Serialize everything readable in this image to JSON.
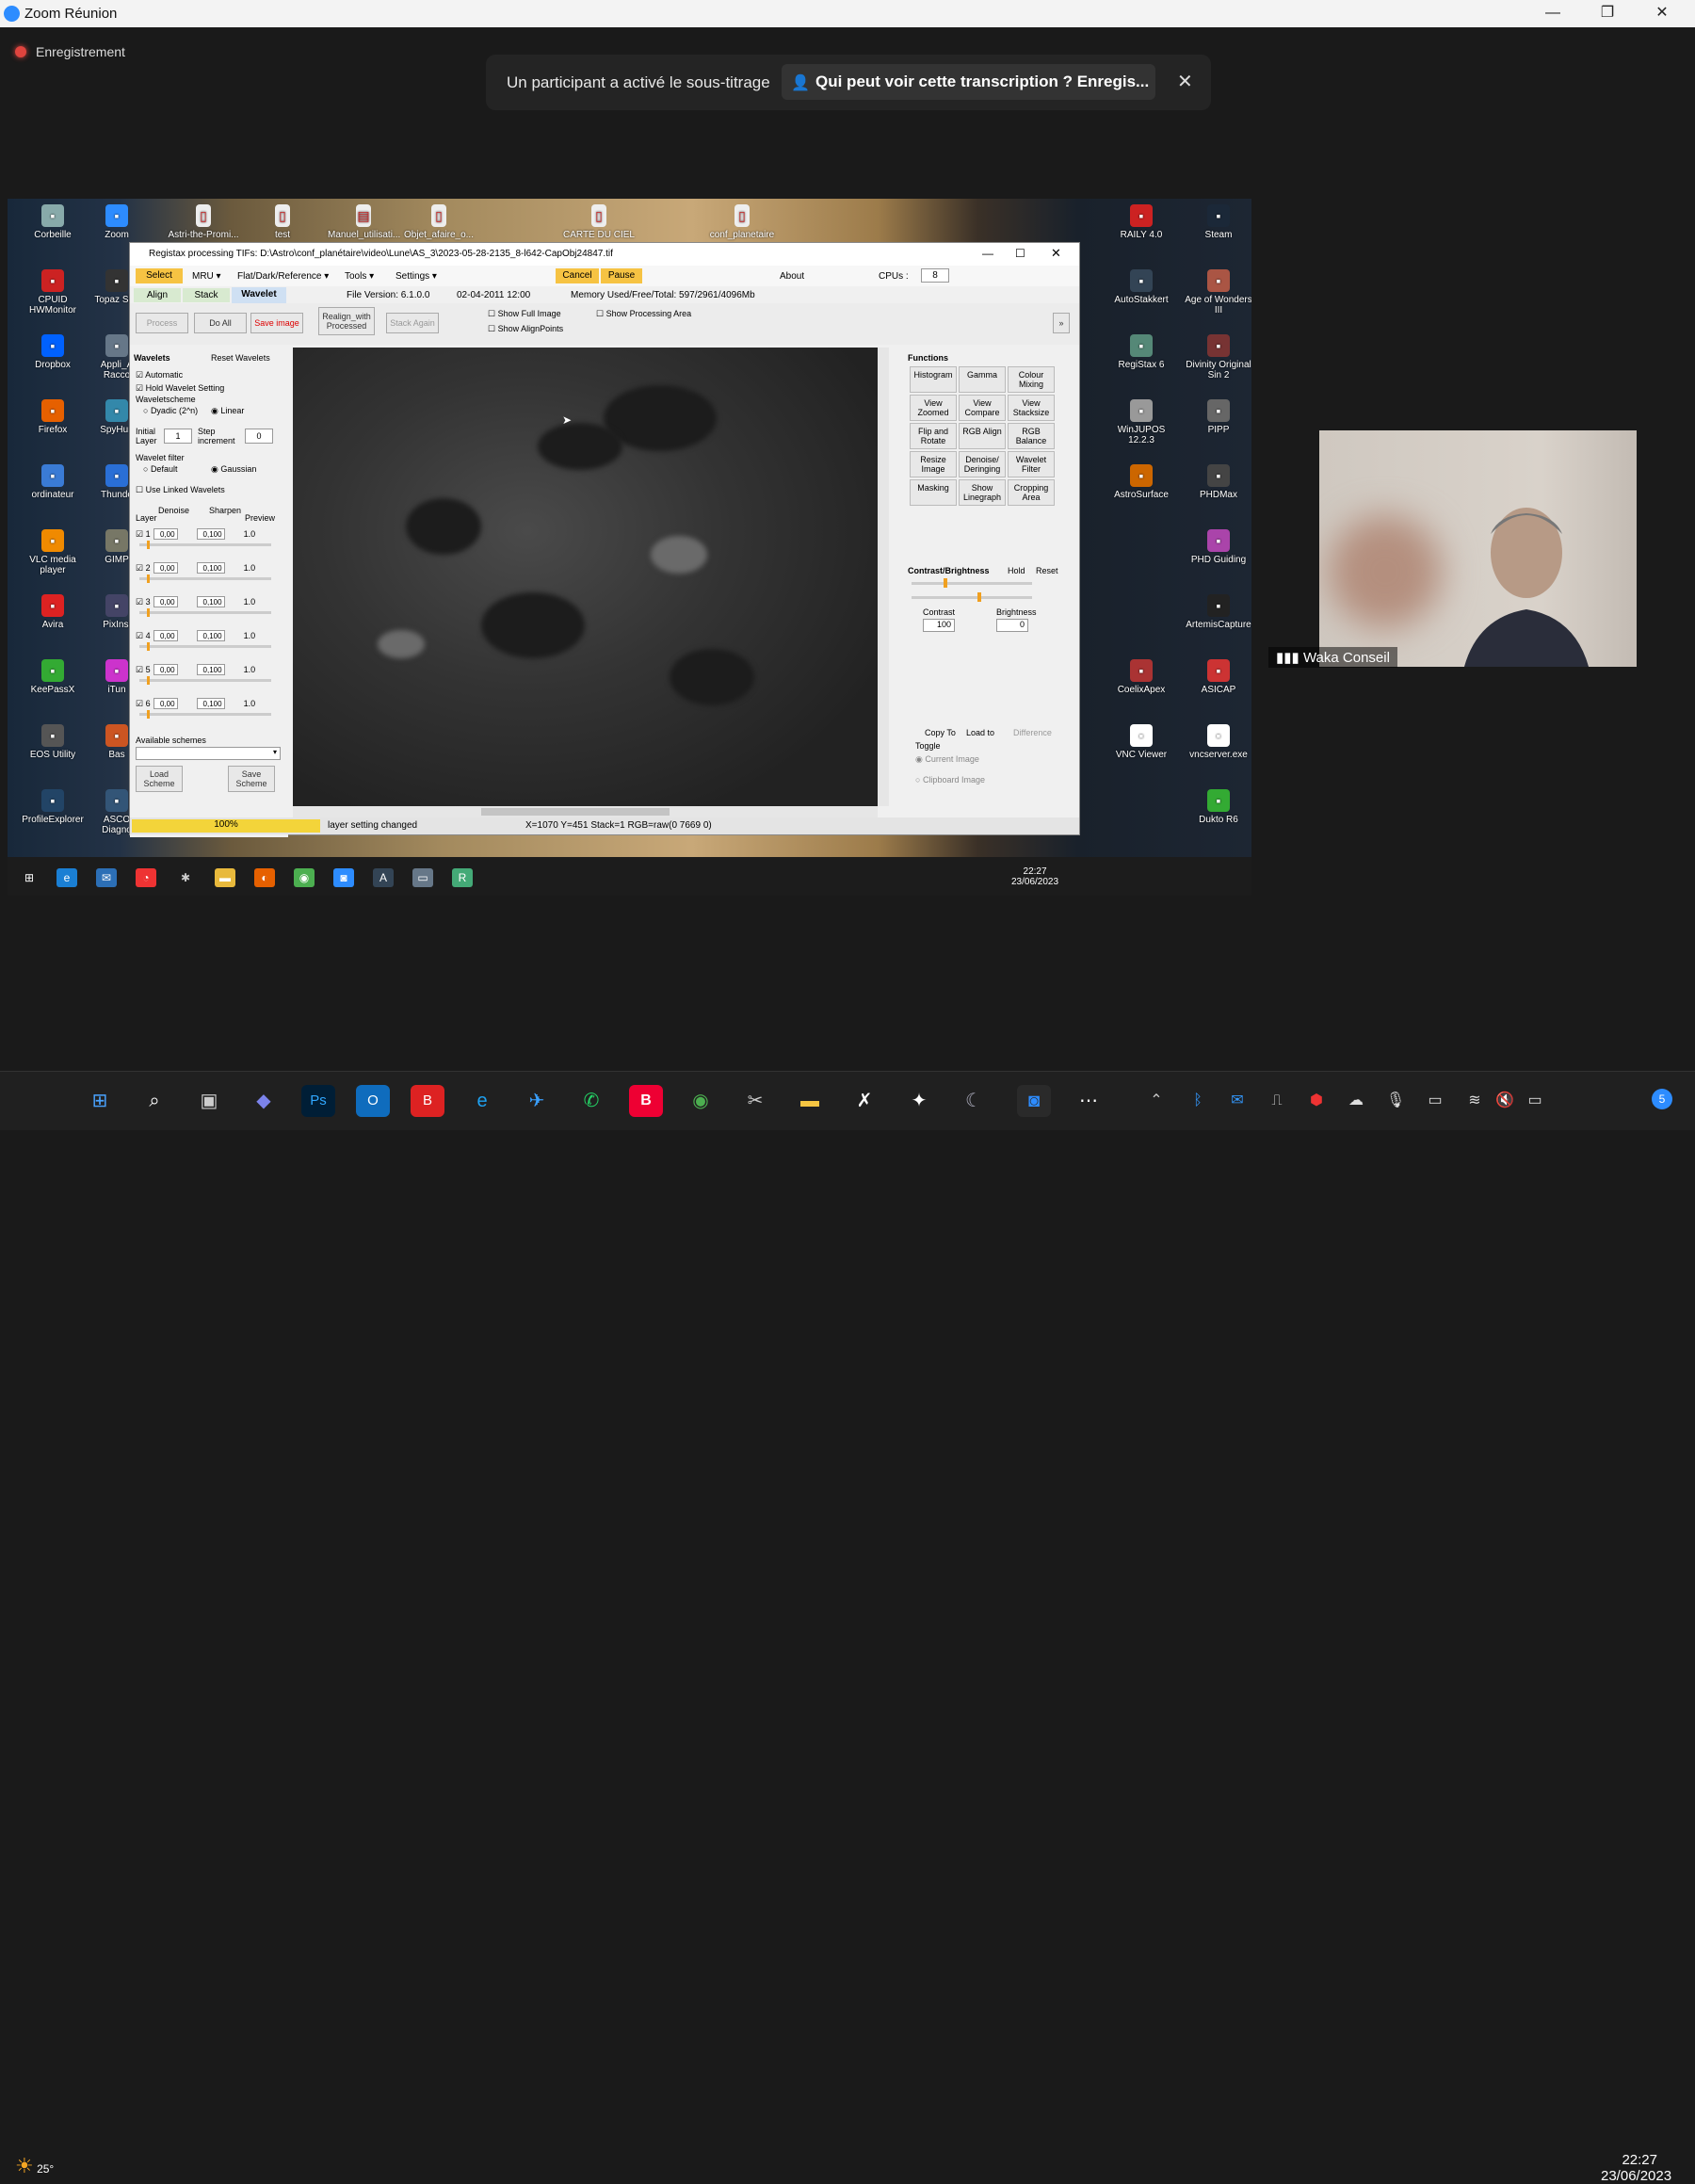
{
  "zoom": {
    "title": "Zoom Réunion",
    "recording_label": "Enregistrement",
    "notification": {
      "message": "Un participant a activé le sous-titrage",
      "action": "Qui peut voir cette transcription ? Enregis...",
      "close": "✕"
    },
    "window_controls": {
      "minimize": "—",
      "restore": "❐",
      "close": "✕"
    },
    "participant_name": "Waka Conseil"
  },
  "shared_screen": {
    "desktop_icons_left": [
      {
        "label": "Corbeille",
        "icon": "recycle-bin-icon",
        "color": "#8aa"
      },
      {
        "label": "CPUID HWMonitor",
        "icon": "hwmonitor-icon",
        "color": "#c22"
      },
      {
        "label": "Dropbox",
        "icon": "dropbox-icon",
        "color": "#0061fe"
      },
      {
        "label": "Firefox",
        "icon": "firefox-icon",
        "color": "#e66000"
      },
      {
        "label": "ordinateur",
        "icon": "computer-icon",
        "color": "#3a7bd5"
      },
      {
        "label": "VLC media player",
        "icon": "vlc-icon",
        "color": "#f08a00"
      },
      {
        "label": "Avira",
        "icon": "avira-icon",
        "color": "#d22"
      },
      {
        "label": "KeePassX",
        "icon": "keepass-icon",
        "color": "#3a3"
      },
      {
        "label": "EOS Utility",
        "icon": "eos-icon",
        "color": "#555"
      },
      {
        "label": "ProfileExplorer",
        "icon": "profile-explorer-icon",
        "color": "#246"
      }
    ],
    "desktop_icons_second": [
      {
        "label": "Zoom",
        "icon": "zoom-icon",
        "color": "#2d8cff"
      },
      {
        "label": "Topaz Sha",
        "icon": "topaz-icon",
        "color": "#333"
      },
      {
        "label": "Appli_A Racco",
        "icon": "app-icon",
        "color": "#678"
      },
      {
        "label": "SpyHun",
        "icon": "spyhunter-icon",
        "color": "#38a"
      },
      {
        "label": "Thunde",
        "icon": "thunderbird-icon",
        "color": "#2a6fd6"
      },
      {
        "label": "GIMP",
        "icon": "gimp-icon",
        "color": "#776"
      },
      {
        "label": "PixInsi",
        "icon": "pixinsight-icon",
        "color": "#446"
      },
      {
        "label": "iTun",
        "icon": "itunes-icon",
        "color": "#c3c"
      },
      {
        "label": "Bas",
        "icon": "app-icon",
        "color": "#c52"
      },
      {
        "label": "ASCO Diagno",
        "icon": "ascom-icon",
        "color": "#357"
      }
    ],
    "desktop_icons_top": [
      {
        "label": "Astri-the-Promi...",
        "icon": "file-icon"
      },
      {
        "label": "test",
        "icon": "file-icon"
      },
      {
        "label": "Manuel_utilisati...",
        "icon": "pdf-icon"
      },
      {
        "label": "Objet_afaire_o...",
        "icon": "file-icon"
      },
      {
        "label": "CARTE DU CIEL",
        "icon": "file-icon"
      },
      {
        "label": "conf_planetaire",
        "icon": "file-icon"
      }
    ],
    "desktop_icons_right1": [
      {
        "label": "RAILY 4.0",
        "icon": "app-icon",
        "color": "#c22"
      },
      {
        "label": "AutoStakkert",
        "icon": "autostakkert-icon",
        "color": "#345"
      },
      {
        "label": "RegiStax 6",
        "icon": "registax-icon",
        "color": "#587"
      },
      {
        "label": "WinJUPOS 12.2.3",
        "icon": "winjupos-icon",
        "color": "#999"
      },
      {
        "label": "AstroSurface",
        "icon": "astrosurface-icon",
        "color": "#c60"
      },
      {
        "label": "",
        "icon": "",
        "color": ""
      },
      {
        "label": "",
        "icon": "",
        "color": ""
      },
      {
        "label": "CoelixApex",
        "icon": "coelix-icon",
        "color": "#a33"
      },
      {
        "label": "VNC Viewer",
        "icon": "vnc-icon",
        "color": "#fff"
      }
    ],
    "desktop_icons_right2": [
      {
        "label": "Steam",
        "icon": "steam-icon",
        "color": "#1b2838"
      },
      {
        "label": "Age of Wonders III",
        "icon": "game-icon",
        "color": "#a54"
      },
      {
        "label": "Divinity Original Sin 2",
        "icon": "game-icon",
        "color": "#733"
      },
      {
        "label": "PIPP",
        "icon": "pipp-icon",
        "color": "#666"
      },
      {
        "label": "PHDMax",
        "icon": "phdmax-icon",
        "color": "#444"
      },
      {
        "label": "PHD Guiding",
        "icon": "phd-icon",
        "color": "#a4a"
      },
      {
        "label": "ArtemisCapture",
        "icon": "artemis-icon",
        "color": "#222"
      },
      {
        "label": "ASICAP",
        "icon": "asicap-icon",
        "color": "#c33"
      },
      {
        "label": "vncserver.exe",
        "icon": "vnc-icon",
        "color": "#fff"
      },
      {
        "label": "Dukto R6",
        "icon": "dukto-icon",
        "color": "#3a3"
      }
    ],
    "registax": {
      "title": "Registax processing TIFs: D:\\Astro\\conf_planétaire\\video\\Lune\\AS_3\\2023-05-28-2135_8-l642-CapObj24847.tif",
      "menu": [
        "Select",
        "MRU ▾",
        "Flat/Dark/Reference ▾",
        "Tools ▾",
        "Settings ▾",
        "Cancel",
        "Pause",
        "About",
        "CPUs :",
        "8"
      ],
      "tabs": [
        "Align",
        "Stack",
        "Wavelet"
      ],
      "file_version": "File Version: 6.1.0.0",
      "date": "02-04-2011 12:00",
      "memory": "Memory Used/Free/Total: 597/2961/4096Mb",
      "toolbar": [
        "Process",
        "Do All",
        "Save image",
        "Realign_with Processed",
        "Stack Again"
      ],
      "options": [
        "Show Full Image",
        "Show Processing Area",
        "Show AlignPoints"
      ],
      "wavelets": {
        "header": "Wavelets",
        "reset": "Reset Wavelets",
        "automatic": "Automatic",
        "hold": "Hold Wavelet Setting",
        "scheme_label": "Waveletscheme",
        "dyadic": "Dyadic (2^n)",
        "linear": "Linear",
        "initial_layer": "Initial Layer",
        "initial_value": "1",
        "step_increment": "Step increment",
        "step_value": "0",
        "filter_label": "Wavelet filter",
        "default": "Default",
        "gaussian": "Gaussian",
        "linked": "Use Linked Wavelets",
        "col_layer": "Layer",
        "col_denoise": "Denoise",
        "col_sharpen": "Sharpen",
        "col_preview": "Preview",
        "layers": [
          {
            "n": "1",
            "denoise": "0,00",
            "sharpen": "0,100",
            "preview": "1.0"
          },
          {
            "n": "2",
            "denoise": "0,00",
            "sharpen": "0,100",
            "preview": "1.0"
          },
          {
            "n": "3",
            "denoise": "0,00",
            "sharpen": "0,100",
            "preview": "1.0"
          },
          {
            "n": "4",
            "denoise": "0,00",
            "sharpen": "0,100",
            "preview": "1.0"
          },
          {
            "n": "5",
            "denoise": "0,00",
            "sharpen": "0,100",
            "preview": "1.0"
          },
          {
            "n": "6",
            "denoise": "0,00",
            "sharpen": "0,100",
            "preview": "1.0"
          }
        ],
        "available": "Available schemes",
        "load": "Load Scheme",
        "save": "Save Scheme"
      },
      "functions": {
        "header": "Functions",
        "buttons": [
          "Histogram",
          "Gamma",
          "Colour Mixing",
          "View Zoomed",
          "View Compare",
          "View Stacksize",
          "Flip and Rotate",
          "RGB Align",
          "RGB Balance",
          "Resize Image",
          "Denoise/ Deringing",
          "Wavelet Filter",
          "Masking",
          "Show Linegraph",
          "Cropping Area"
        ],
        "contrast_header": "Contrast/Brightness",
        "hold": "Hold",
        "reset": "Reset",
        "contrast": "Contrast",
        "contrast_val": "100",
        "brightness": "Brightness",
        "brightness_val": "0",
        "copy_to": "Copy To",
        "load_to": "Load to",
        "difference": "Difference",
        "toggle": "Toggle",
        "current": "Current Image",
        "clipboard": "Clipboard Image"
      },
      "status": {
        "progress": "100%",
        "message": "layer setting changed",
        "coords": "X=1070 Y=451 Stack=1 RGB=raw(0 7669 0)"
      }
    },
    "taskbar_time": "22:27",
    "taskbar_date": "23/06/2023"
  },
  "host_taskbar": {
    "weather": "25°",
    "time": "22:27",
    "date": "23/06/2023",
    "notification_count": "5",
    "apps": [
      "start-icon",
      "search-icon",
      "task-view-icon",
      "teams-icon",
      "photoshop-icon",
      "outlook-icon",
      "bitdefender-icon",
      "edge-icon",
      "email-icon",
      "whatsapp-icon",
      "b-app-icon",
      "chrome-icon",
      "snipping-icon",
      "explorer-icon",
      "kleopatra-icon",
      "astro-pro-icon",
      "stellarium-icon",
      "zoom-icon",
      "more-icon"
    ]
  }
}
